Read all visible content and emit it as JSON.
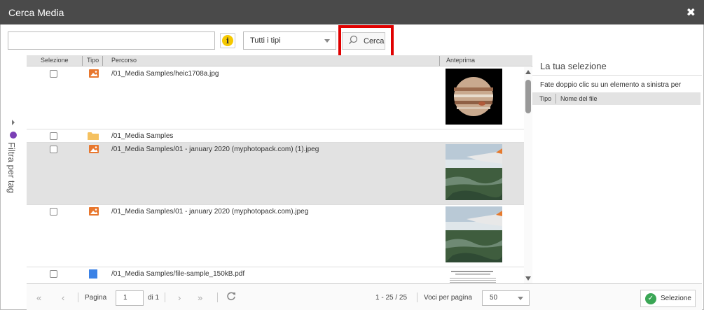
{
  "window": {
    "title": "Cerca Media",
    "close_symbol": "✖"
  },
  "toolbar": {
    "search_value": "",
    "info_symbol": "i",
    "type_filter": "Tutti i tipi",
    "search_button": "Cerca"
  },
  "sidebar": {
    "filter_label": "Filtra per tag"
  },
  "grid": {
    "columns": {
      "selection": "Selezione",
      "type": "Tipo",
      "path": "Percorso",
      "preview": "Anteprima"
    },
    "rows": [
      {
        "type": "image",
        "path": "/01_Media Samples/heic1708a.jpg",
        "preview": "planet",
        "selected": false
      },
      {
        "type": "folder",
        "path": "/01_Media Samples",
        "preview": "none",
        "selected": false
      },
      {
        "type": "image",
        "path": "/01_Media Samples/01 - january 2020 (myphotopack.com) (1).jpeg",
        "preview": "aerial",
        "selected": false,
        "highlighted": true
      },
      {
        "type": "image",
        "path": "/01_Media Samples/01 - january 2020 (myphotopack.com).jpeg",
        "preview": "aerial",
        "selected": false
      },
      {
        "type": "pdf",
        "path": "/01_Media Samples/file-sample_150kB.pdf",
        "preview": "document",
        "selected": false
      }
    ]
  },
  "pager": {
    "page_label": "Pagina",
    "page_value": "1",
    "of_label": "di 1",
    "range_text": "1 - 25 / 25",
    "per_page_label": "Voci per pagina",
    "per_page_value": "50"
  },
  "selection_panel": {
    "title": "La tua selezione",
    "hint": "Fate doppio clic su un elemento a sinistra per",
    "columns": {
      "type": "Tipo",
      "filename": "Nome del file"
    },
    "select_button": "Selezione"
  },
  "colors": {
    "titlebar": "#4a4a4a",
    "highlight": "#e00000",
    "image_icon": "#e8772e",
    "folder_icon": "#f5c160",
    "pdf_icon": "#3b82e6",
    "tag_icon": "#7b3fb5",
    "ok_icon": "#3aa655"
  }
}
